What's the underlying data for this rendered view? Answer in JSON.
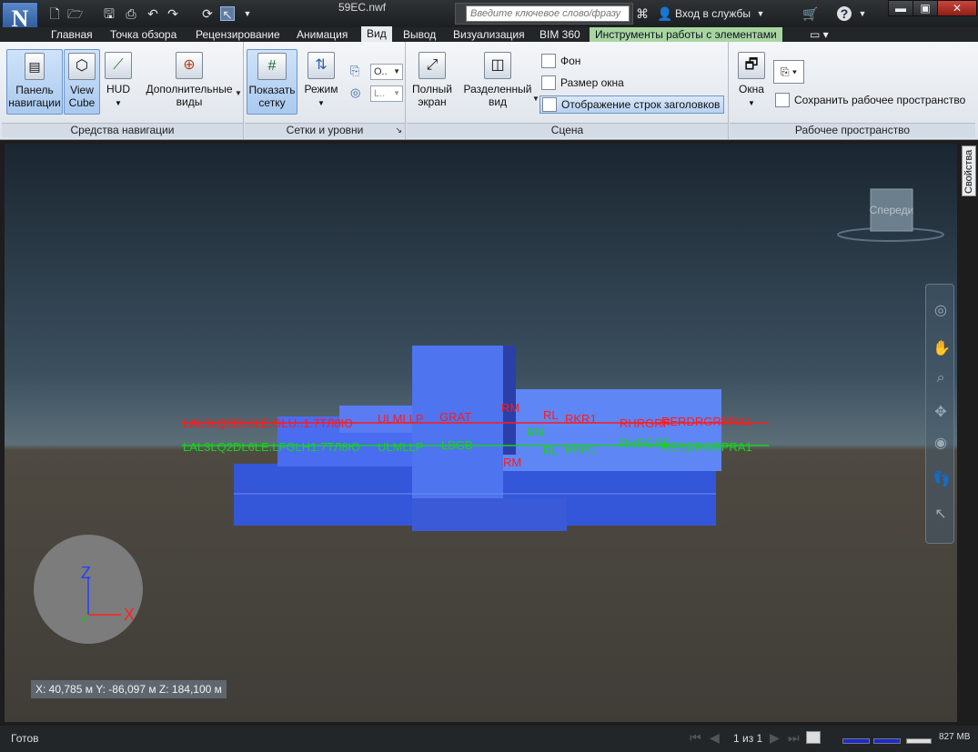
{
  "title_bar": {
    "app_logo": "N",
    "filename": "59EC.nwf",
    "search_placeholder": "Введите ключевое слово/фразу",
    "signin_label": "Вход в службы",
    "help_label": "?"
  },
  "tabs": [
    {
      "label": "Главная"
    },
    {
      "label": "Точка обзора"
    },
    {
      "label": "Рецензирование"
    },
    {
      "label": "Анимация"
    },
    {
      "label": "Вид"
    },
    {
      "label": "Вывод"
    },
    {
      "label": "Визуализация"
    },
    {
      "label": "BIM 360"
    },
    {
      "label": "Инструменты работы с элементами"
    }
  ],
  "ribbon": {
    "nav_panel": {
      "title": "Средства навигации",
      "nav_bar_btn": "Панель навигации",
      "viewcube_btn": "View Cube",
      "hud_btn": "HUD",
      "extra_views_btn": "Дополнительные виды"
    },
    "grids_panel": {
      "title": "Сетки и уровни",
      "show_grid_btn": "Показать сетку",
      "mode_btn": "Режим",
      "combo1": "О..",
      "combo2": "L.."
    },
    "scene_panel": {
      "title": "Сцена",
      "fullscreen_btn": "Полный экран",
      "split_btn": "Разделенный вид",
      "background": "Фон",
      "window_size": "Размер окна",
      "header_rows": "Отображение строк заголовков"
    },
    "workspace_panel": {
      "title": "Рабочее пространство",
      "windows_btn": "Окна",
      "save_workspace": "Сохранить рабочее пространство"
    }
  },
  "side_tab": "Свойства",
  "viewcube_face": "Спереди",
  "axis_labels": {
    "z": "Z",
    "x": "X"
  },
  "coords_readout": "X: 40,785 м  Y: -86,097 м  Z: 184,100 м",
  "status": {
    "ready": "Готов",
    "page": "1 из 1",
    "memory": "827 MB"
  },
  "grid_labels_red": [
    "LAL3LQ2DL6LE.GLU..1.7ТЛ8Ю",
    "ULMLLP",
    "GRAT",
    "RM",
    "RL",
    "RKR1",
    "RHRGRF",
    "RERDRGRPRA1"
  ],
  "grid_labels_green": [
    "LAL3LQ2DL6LE.LFGLH1.7ТЛ8Ю",
    "ULMLLP",
    "LBGB",
    "RN",
    "RL",
    "RKR1",
    "RHRGRF",
    "RERDRGRPRA1",
    "RM"
  ],
  "colors": {
    "building": "#3f6fe8",
    "grid_red": "#ff1a1a",
    "grid_green": "#19d219",
    "context_tab": "#a8d6a1"
  }
}
